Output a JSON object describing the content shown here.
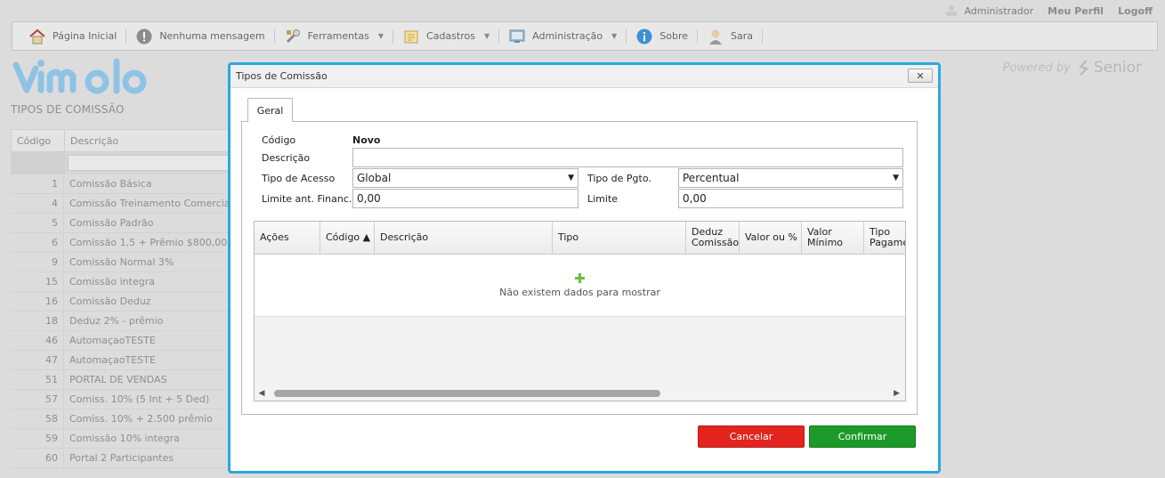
{
  "top_links": {
    "admin": "Administrador",
    "profile": "Meu Perfil",
    "logoff": "Logoff"
  },
  "menu": [
    {
      "label": "Página Inicial",
      "icon": "home-icon",
      "dropdown": false
    },
    {
      "label": "Nenhuma mensagem",
      "icon": "alert-icon",
      "dropdown": false
    },
    {
      "label": "Ferramentas",
      "icon": "tools-icon",
      "dropdown": true
    },
    {
      "label": "Cadastros",
      "icon": "folder-icon",
      "dropdown": true
    },
    {
      "label": "Administração",
      "icon": "admin-icon",
      "dropdown": true
    },
    {
      "label": "Sobre",
      "icon": "info-icon",
      "dropdown": false
    },
    {
      "label": "Sara",
      "icon": "user-avatar-icon",
      "dropdown": false
    }
  ],
  "logo": {
    "text": "vimob"
  },
  "powered_by": {
    "label": "Powered by",
    "brand": "Senior"
  },
  "page_title": "TIPOS DE COMISSÃO",
  "background_grid": {
    "columns": [
      "Código",
      "Descrição"
    ],
    "rows": [
      {
        "code": "1",
        "desc": "Comissão Básica"
      },
      {
        "code": "4",
        "desc": "Comissão Treinamento Comercial"
      },
      {
        "code": "5",
        "desc": "Comissão Padrão"
      },
      {
        "code": "6",
        "desc": "Comissão 1,5 + Prêmio $800,00"
      },
      {
        "code": "9",
        "desc": "Comissão Normal 3%"
      },
      {
        "code": "15",
        "desc": "Comissão integra"
      },
      {
        "code": "16",
        "desc": "Comissão Deduz"
      },
      {
        "code": "18",
        "desc": "Deduz 2% - prêmio"
      },
      {
        "code": "46",
        "desc": "AutomaçaoTESTE"
      },
      {
        "code": "47",
        "desc": "AutomaçaoTESTE"
      },
      {
        "code": "51",
        "desc": "PORTAL DE VENDAS"
      },
      {
        "code": "57",
        "desc": "Comiss. 10% (5 Int + 5 Ded)"
      },
      {
        "code": "58",
        "desc": "Comiss. 10% + 2.500 prêmio"
      },
      {
        "code": "59",
        "desc": "Comissão 10% integra"
      },
      {
        "code": "60",
        "desc": "Portal 2 Participantes"
      }
    ]
  },
  "dialog": {
    "title": "Tipos de Comissão",
    "close_label": "✕",
    "tab": "Geral",
    "form": {
      "codigo_label": "Código",
      "codigo_value": "Novo",
      "descricao_label": "Descrição",
      "descricao_value": "",
      "tipo_acesso_label": "Tipo de Acesso",
      "tipo_acesso_value": "Global",
      "tipo_pgto_label": "Tipo de Pgto.",
      "tipo_pgto_value": "Percentual",
      "limite_ant_label": "Limite ant. Financ.",
      "limite_ant_value": "0,00",
      "limite_label": "Limite",
      "limite_value": "0,00"
    },
    "grid": {
      "columns": [
        {
          "label": "Ações"
        },
        {
          "label": "Código ▲"
        },
        {
          "label": "Descrição"
        },
        {
          "label": "Tipo"
        },
        {
          "label": "Deduz\nComissão"
        },
        {
          "label": "Valor ou %"
        },
        {
          "label": "Valor\nMínimo"
        },
        {
          "label": "Tipo\nPagamento"
        }
      ],
      "empty_text": "Não existem dados para mostrar"
    },
    "buttons": {
      "cancel": "Cancelar",
      "confirm": "Confirmar"
    }
  },
  "colors": {
    "dialog_border": "#2ea7de",
    "cancel": "#e3241f",
    "confirm": "#1c9a29",
    "logo": "#8fc3e6"
  }
}
